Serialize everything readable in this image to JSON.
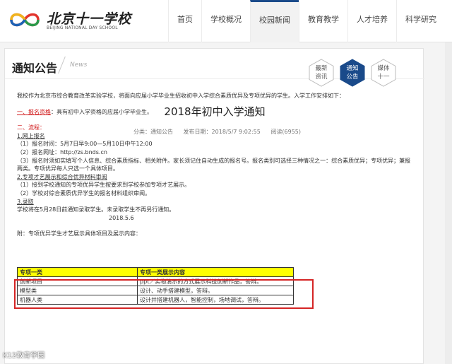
{
  "brand": {
    "name_cn": "北京十一学校",
    "name_en": "BEIJING NATIONAL DAY SCHOOL"
  },
  "nav": [
    {
      "label": "首页",
      "active": false
    },
    {
      "label": "学校概况",
      "active": false
    },
    {
      "label": "校园新闻",
      "active": true
    },
    {
      "label": "教育教学",
      "active": false
    },
    {
      "label": "人才培养",
      "active": false
    },
    {
      "label": "科学研究",
      "active": false
    }
  ],
  "section": {
    "title": "通知公告",
    "subtitle": "News"
  },
  "subnav": [
    {
      "label": "最新\n资讯",
      "active": false
    },
    {
      "label": "通知\n公告",
      "active": true
    },
    {
      "label": "媒体\n十一",
      "active": false
    }
  ],
  "article": {
    "title": "2018年初中入学通知",
    "meta": {
      "category": "分类：通知公告",
      "date": "发布日期：2018/5/7 9:02:55",
      "views": "阅读(6955)"
    },
    "intro": "我校作为北京市综合教育改革实验学校，将面向应届小学毕业生招收初中入学综合素质优异及专项优异的学生。入学工作安排如下：",
    "s1_head": "一、报名资格",
    "s1_text": "：具有初中入学资格的应届小学毕业生。",
    "s2_head": "二、流程：",
    "step1": "1.网上报名",
    "step1_a": "（1）报名时间：5月7日早9:00—5月10日中午12:00",
    "step1_b": "（2）报名网址：http://zs.bnds.cn",
    "step1_c": "（3）报名时须如实填写个人信息、综合素质指标、相关附件。家长须记住自动生成的报名号。报名类别可选择三种情况之一：综合素质优异；专项优异；兼报两类。专项优异每人只选一个具体项目。",
    "step2": "2.专项才艺展示和综合优异材料审阅",
    "step2_a": "（1）接到学校通知的专项优异学生按要求到学校参加专项才艺展示。",
    "step2_b": "（2）学校对综合素质优异学生的报名材料组织审阅。",
    "step3": "3.录取",
    "step3_a": "学校将在5月28日前通知录取学生。未录取学生不再另行通知。",
    "sign_date": "2018.5.6",
    "attach": "附：专项优异学生才艺展示具体项目及展示内容："
  },
  "table": {
    "headers": [
      "专项一类",
      "专项一类展示内容"
    ],
    "rows": [
      [
        "创新项目",
        "ppt／实物演示的方式展示科技创新作品，答辩。"
      ],
      [
        "模型类",
        "设计、动手搭建模型，答辩。"
      ],
      [
        "机器人类",
        "设计并搭建机器人，智能控制，场地调试，答辩。"
      ]
    ]
  },
  "watermark": "K12教育学园",
  "colors": {
    "accent": "#1a4a8a",
    "alert": "#d0191a",
    "highlight": "#ffff00"
  }
}
